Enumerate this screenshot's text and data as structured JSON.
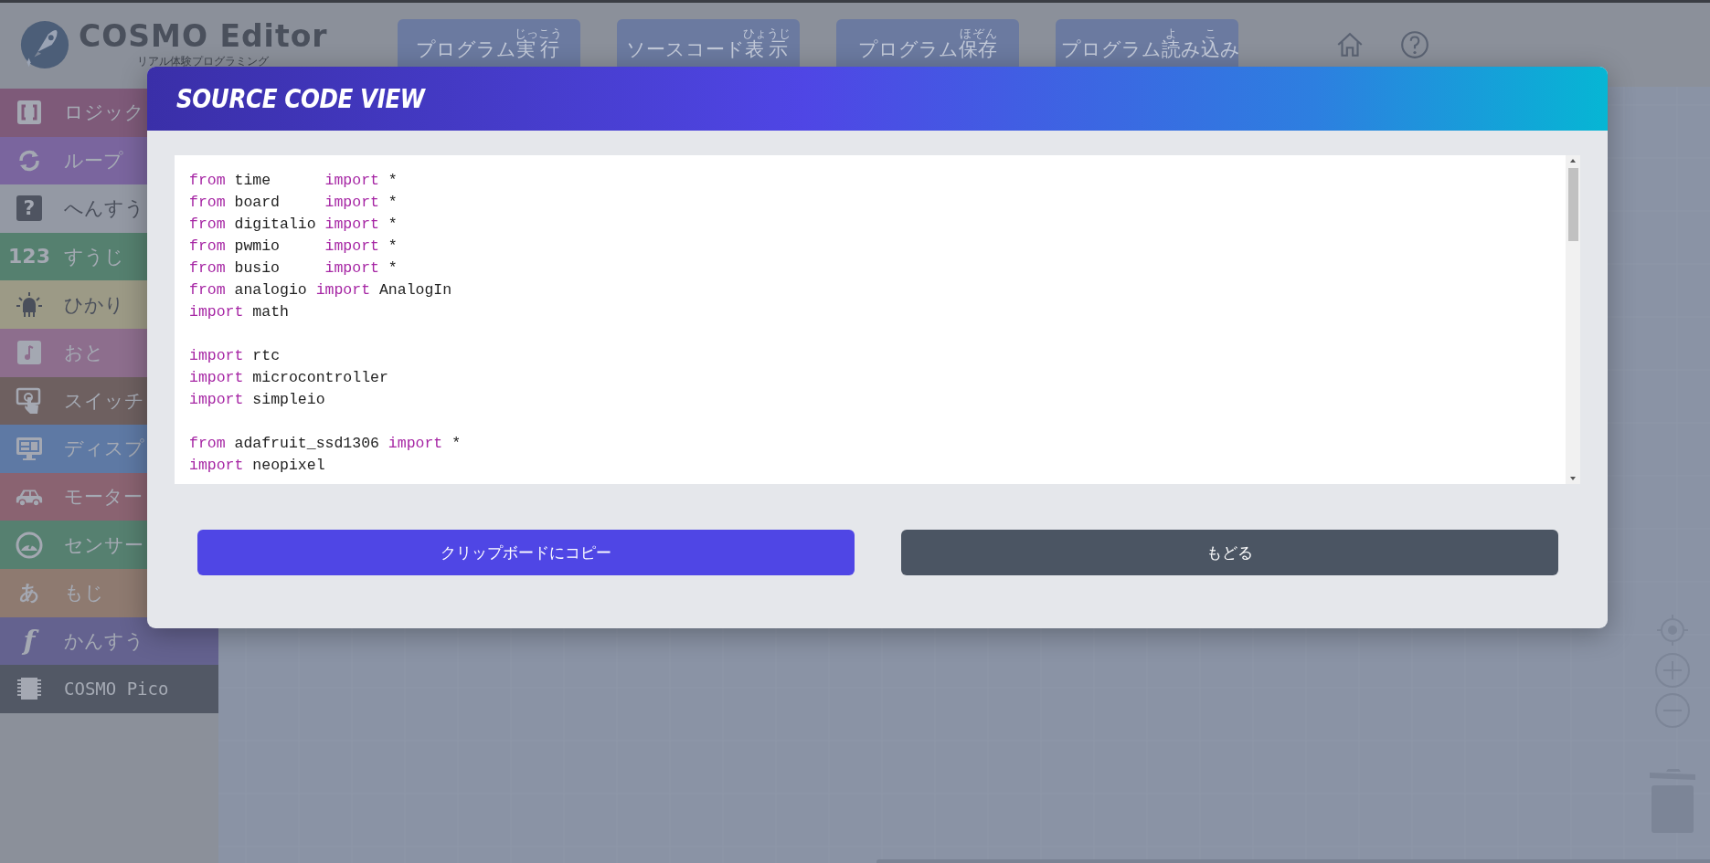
{
  "header": {
    "app_name": "COSMO Editor",
    "tagline": "リアル体験プログラミング",
    "buttons": [
      {
        "parts": [
          {
            "text": "プログラム"
          },
          {
            "base": "実行",
            "ruby": "じっこう"
          }
        ]
      },
      {
        "parts": [
          {
            "text": "ソースコード"
          },
          {
            "base": "表示",
            "ruby": "ひょうじ"
          }
        ]
      },
      {
        "parts": [
          {
            "text": "プログラム"
          },
          {
            "base": "保存",
            "ruby": "ほぞん"
          }
        ]
      },
      {
        "parts": [
          {
            "text": "プログラム"
          },
          {
            "base": "読",
            "ruby": "よ"
          },
          {
            "text": "み"
          },
          {
            "base": "込",
            "ruby": "こ"
          },
          {
            "text": "み"
          }
        ]
      }
    ]
  },
  "sidebar": {
    "items": [
      {
        "label": "ロジック",
        "kind": "brackets",
        "color": "#7e5a79"
      },
      {
        "label": "ループ",
        "kind": "loop",
        "color": "#7a659e"
      },
      {
        "label": "へんすう",
        "kind": "glyph",
        "glyph": "?",
        "color": "#9499a4"
      },
      {
        "label": "すうじ",
        "kind": "glyph",
        "glyph": "123",
        "color": "#55806f"
      },
      {
        "label": "ひかり",
        "kind": "bulb",
        "color": "#9c9a86"
      },
      {
        "label": "おと",
        "kind": "note",
        "color": "#8d6e8d"
      },
      {
        "label": "スイッチ",
        "kind": "touch",
        "color": "#6e6060"
      },
      {
        "label": "ディスプ",
        "kind": "monitor",
        "color": "#5e79a4"
      },
      {
        "label": "モーター",
        "kind": "car",
        "color": "#8a6371"
      },
      {
        "label": "センサー",
        "kind": "gauge",
        "color": "#568070"
      },
      {
        "label": "もじ",
        "kind": "glyph",
        "glyph": "あ",
        "color": "#8e7a70"
      },
      {
        "label": "かんすう",
        "kind": "glyph",
        "glyph": "f",
        "color": "#64628f"
      },
      {
        "label": "COSMO Pico",
        "kind": "chip",
        "color": "#525865"
      }
    ]
  },
  "dialog": {
    "title": "SOURCE CODE VIEW",
    "code_lines": [
      {
        "kind": "code",
        "parts": [
          {
            "kind": "keyword",
            "text": "from"
          },
          {
            "kind": "plain",
            "text": " time      "
          },
          {
            "kind": "keyword",
            "text": "import"
          },
          {
            "kind": "plain",
            "text": " *"
          }
        ]
      },
      {
        "kind": "code",
        "parts": [
          {
            "kind": "keyword",
            "text": "from"
          },
          {
            "kind": "plain",
            "text": " board     "
          },
          {
            "kind": "keyword",
            "text": "import"
          },
          {
            "kind": "plain",
            "text": " *"
          }
        ]
      },
      {
        "kind": "code",
        "parts": [
          {
            "kind": "keyword",
            "text": "from"
          },
          {
            "kind": "plain",
            "text": " digitalio "
          },
          {
            "kind": "keyword",
            "text": "import"
          },
          {
            "kind": "plain",
            "text": " *"
          }
        ]
      },
      {
        "kind": "code",
        "parts": [
          {
            "kind": "keyword",
            "text": "from"
          },
          {
            "kind": "plain",
            "text": " pwmio     "
          },
          {
            "kind": "keyword",
            "text": "import"
          },
          {
            "kind": "plain",
            "text": " *"
          }
        ]
      },
      {
        "kind": "code",
        "parts": [
          {
            "kind": "keyword",
            "text": "from"
          },
          {
            "kind": "plain",
            "text": " busio     "
          },
          {
            "kind": "keyword",
            "text": "import"
          },
          {
            "kind": "plain",
            "text": " *"
          }
        ]
      },
      {
        "kind": "code",
        "parts": [
          {
            "kind": "keyword",
            "text": "from"
          },
          {
            "kind": "plain",
            "text": " analogio "
          },
          {
            "kind": "keyword",
            "text": "import"
          },
          {
            "kind": "plain",
            "text": " AnalogIn"
          }
        ]
      },
      {
        "kind": "code",
        "parts": [
          {
            "kind": "keyword",
            "text": "import"
          },
          {
            "kind": "plain",
            "text": " math"
          }
        ]
      },
      {
        "kind": "blank"
      },
      {
        "kind": "code",
        "parts": [
          {
            "kind": "keyword",
            "text": "import"
          },
          {
            "kind": "plain",
            "text": " rtc"
          }
        ]
      },
      {
        "kind": "code",
        "parts": [
          {
            "kind": "keyword",
            "text": "import"
          },
          {
            "kind": "plain",
            "text": " microcontroller"
          }
        ]
      },
      {
        "kind": "code",
        "parts": [
          {
            "kind": "keyword",
            "text": "import"
          },
          {
            "kind": "plain",
            "text": " simpleio"
          }
        ]
      },
      {
        "kind": "blank"
      },
      {
        "kind": "code",
        "parts": [
          {
            "kind": "keyword",
            "text": "from"
          },
          {
            "kind": "plain",
            "text": " adafruit_ssd1306 "
          },
          {
            "kind": "keyword",
            "text": "import"
          },
          {
            "kind": "plain",
            "text": " *"
          }
        ]
      },
      {
        "kind": "code",
        "parts": [
          {
            "kind": "keyword",
            "text": "import"
          },
          {
            "kind": "plain",
            "text": " neopixel"
          }
        ]
      }
    ],
    "buttons": [
      {
        "label": "クリップボードにコピー",
        "kind": "primary"
      },
      {
        "label": "もどる",
        "kind": "secondary"
      }
    ]
  }
}
